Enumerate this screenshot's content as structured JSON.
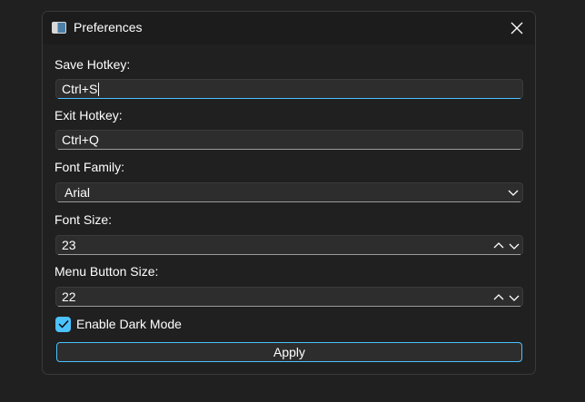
{
  "window": {
    "title": "Preferences"
  },
  "form": {
    "save_hotkey": {
      "label": "Save Hotkey:",
      "value": "Ctrl+S"
    },
    "exit_hotkey": {
      "label": "Exit Hotkey:",
      "value": "Ctrl+Q"
    },
    "font_family": {
      "label": "Font Family:",
      "value": "Arial"
    },
    "font_size": {
      "label": "Font Size:",
      "value": "23"
    },
    "menu_button_size": {
      "label": "Menu Button Size:",
      "value": "22"
    },
    "dark_mode": {
      "label": "Enable Dark Mode",
      "checked": true
    },
    "apply_label": "Apply"
  },
  "colors": {
    "accent": "#4cc2ff",
    "background": "#202020",
    "field_background": "#2d2d2d"
  },
  "icons": {
    "app": "window-icon",
    "close": "close-icon",
    "dropdown": "chevron-down-icon",
    "spin_up": "chevron-up-icon",
    "spin_down": "chevron-down-icon",
    "check": "checkmark-icon"
  }
}
